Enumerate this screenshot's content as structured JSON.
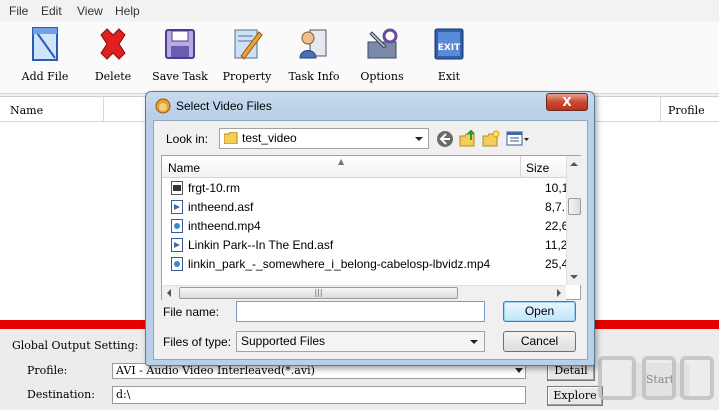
{
  "menu": [
    "File",
    "Edit",
    "View",
    "Help"
  ],
  "toolbar": [
    {
      "label": "Add File",
      "icon": "add-file-icon"
    },
    {
      "label": "Delete",
      "icon": "delete-x-icon"
    },
    {
      "label": "Save Task",
      "icon": "save-disk-icon"
    },
    {
      "label": "Property",
      "icon": "property-pencil-icon"
    },
    {
      "label": "Task Info",
      "icon": "task-info-icon"
    },
    {
      "label": "Options",
      "icon": "options-tools-icon"
    },
    {
      "label": "Exit",
      "icon": "exit-icon"
    }
  ],
  "file_list": {
    "columns": {
      "name": "Name",
      "profile": "Profile"
    }
  },
  "bottom": {
    "global_label": "Global Output Setting:",
    "profile_label": "Profile:",
    "profile_value": "AVI - Audio Video Interleaved(*.avi)",
    "destination_label": "Destination:",
    "destination_value": "d:\\",
    "detail_button": "Detail",
    "explore_button": "Explore",
    "start_button": "Start"
  },
  "dialog": {
    "title": "Select Video Files",
    "look_in_label": "Look in:",
    "look_in_value": "test_video",
    "columns": {
      "name": "Name",
      "size": "Size"
    },
    "files": [
      {
        "name": "frgt-10.rm",
        "size": "10,1("
      },
      {
        "name": "intheend.asf",
        "size": "8,7..."
      },
      {
        "name": "intheend.mp4",
        "size": "22,6!"
      },
      {
        "name": "Linkin Park--In The End.asf",
        "size": "11,2("
      },
      {
        "name": "linkin_park_-_somewhere_i_belong-cabelosp-lbvidz.mp4",
        "size": "25,4..."
      }
    ],
    "file_name_label": "File name:",
    "file_name_value": "",
    "files_of_type_label": "Files of type:",
    "files_of_type_value": "Supported Files",
    "open_button": "Open",
    "cancel_button": "Cancel",
    "close_glyph": "X"
  },
  "colors": {
    "accent_red": "#e60000",
    "title_blue": "#b7cfe7"
  }
}
